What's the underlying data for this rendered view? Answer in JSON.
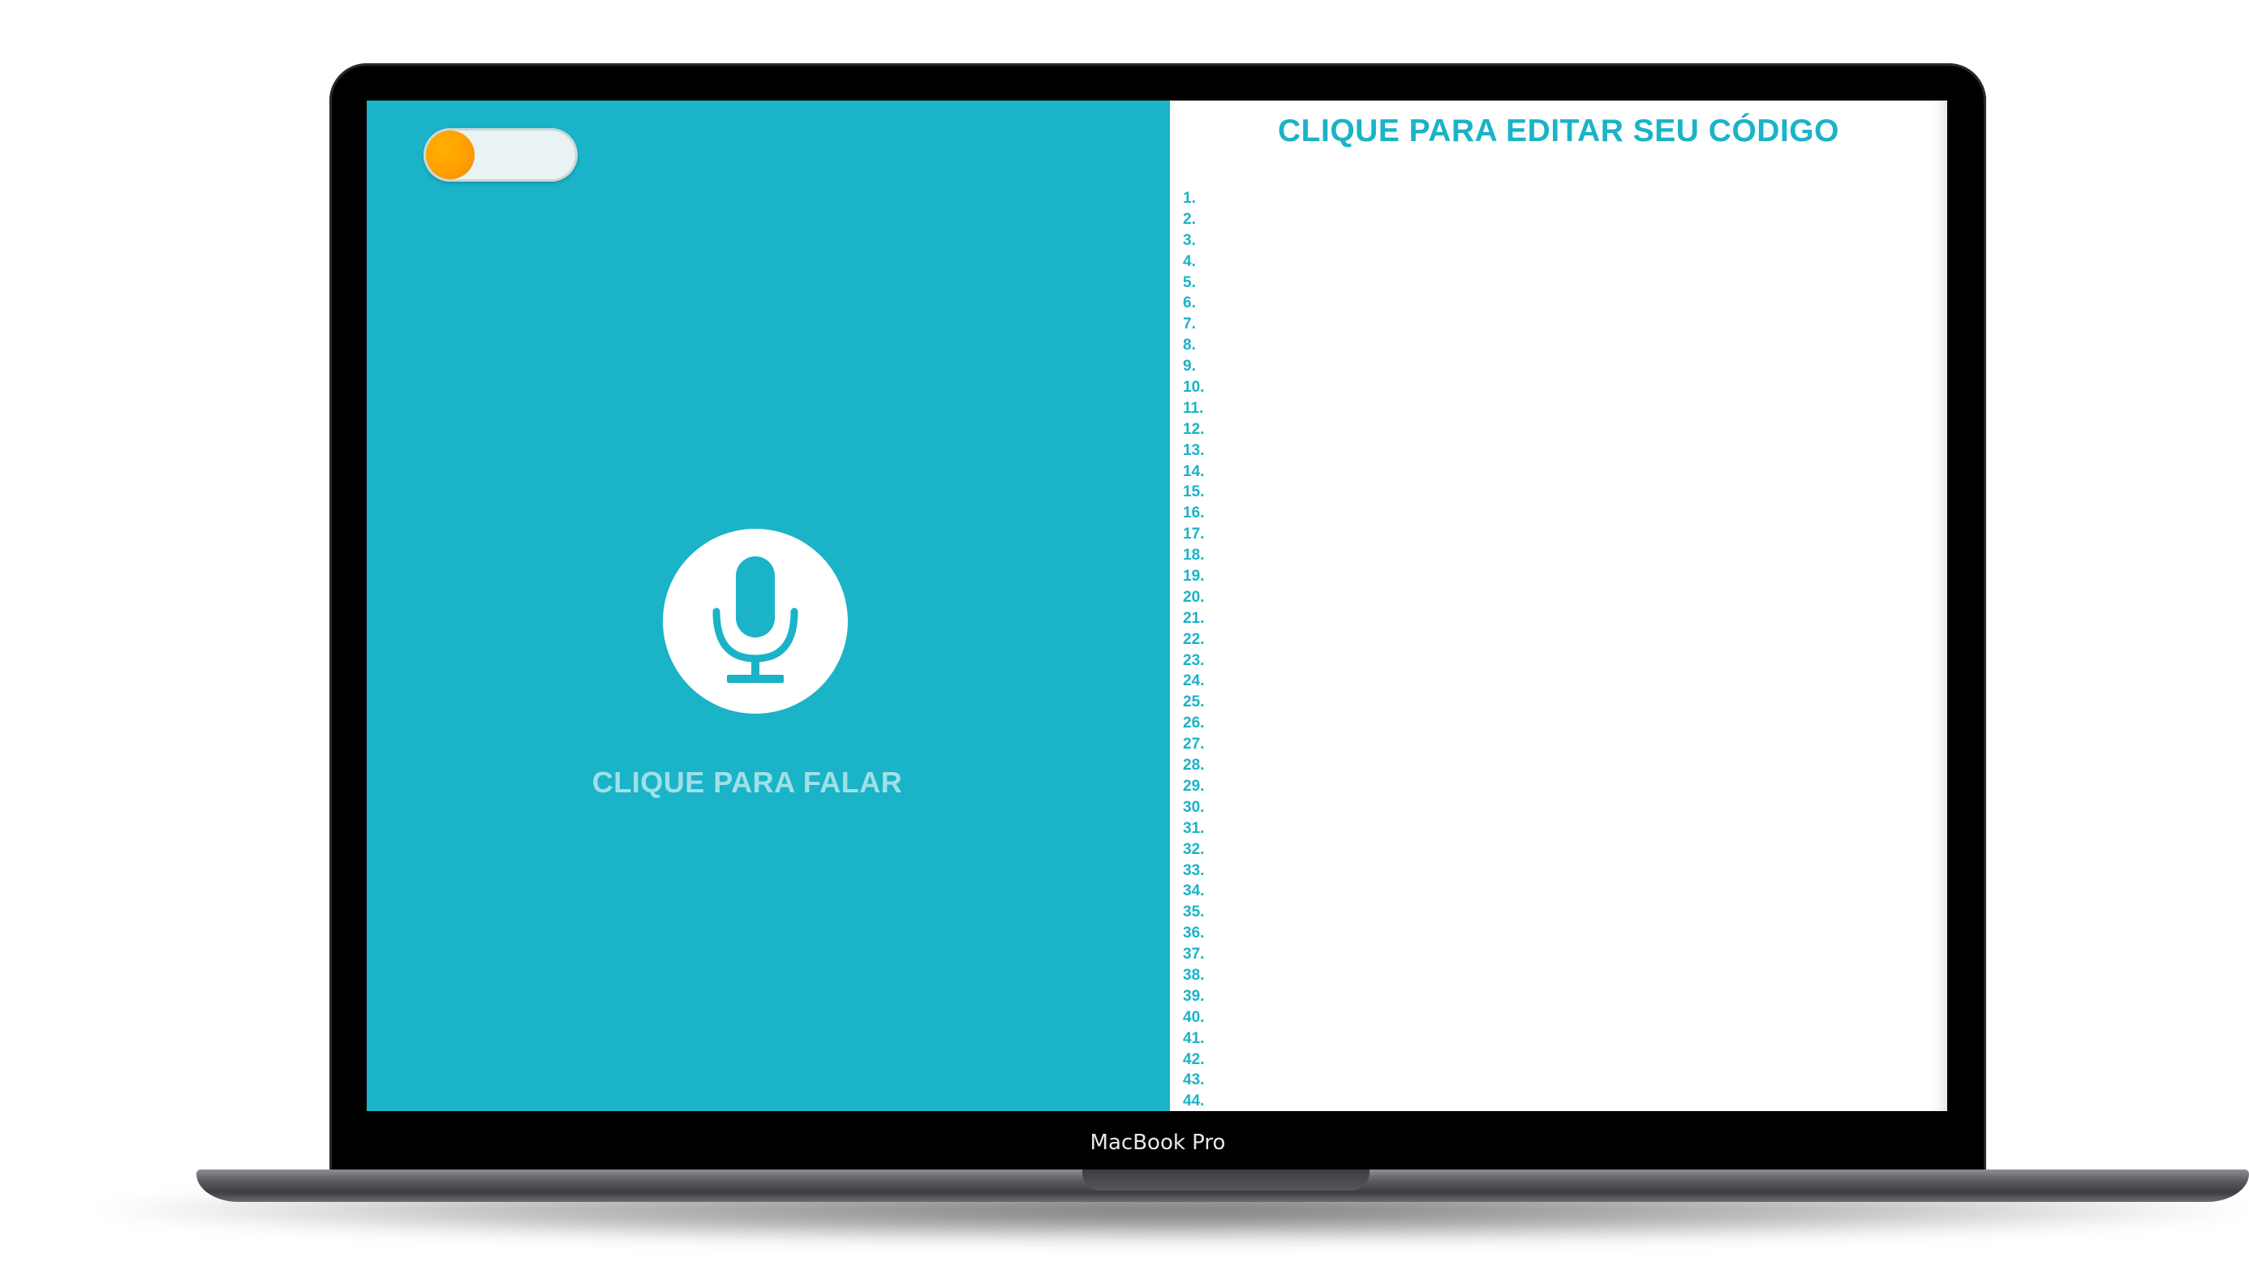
{
  "device": {
    "model_label": "MacBook Pro"
  },
  "left_panel": {
    "background_color": "#1ab3c7",
    "toggle": {
      "state": "off",
      "knob_color": "#ff9f00"
    },
    "mic_icon": "microphone-icon",
    "speak_label": "CLIQUE PARA FALAR"
  },
  "editor": {
    "title": "CLIQUE PARA EDITAR SEU CÓDIGO",
    "accent_color": "#1ab3c7",
    "line_numbers": [
      "1.",
      "2.",
      "3.",
      "4.",
      "5.",
      "6.",
      "7.",
      "8.",
      "9.",
      "10.",
      "11.",
      "12.",
      "13.",
      "14.",
      "15.",
      "16.",
      "17.",
      "18.",
      "19.",
      "20.",
      "21.",
      "22.",
      "23.",
      "24.",
      "25.",
      "26.",
      "27.",
      "28.",
      "29.",
      "30.",
      "31.",
      "32.",
      "33.",
      "34.",
      "35.",
      "36.",
      "37.",
      "38.",
      "39.",
      "40.",
      "41.",
      "42.",
      "43.",
      "44."
    ]
  }
}
